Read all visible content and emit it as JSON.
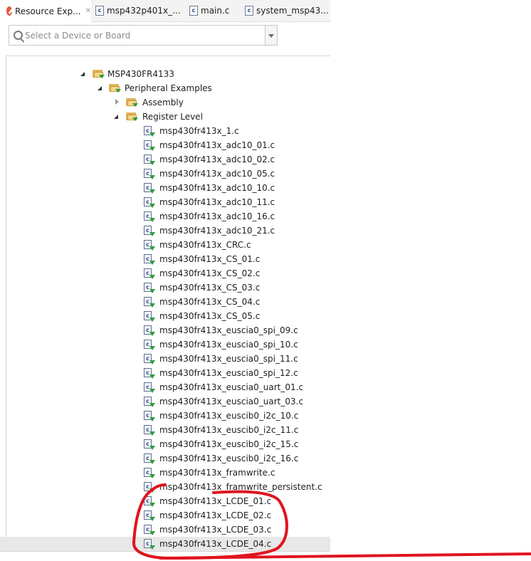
{
  "tabs": [
    {
      "label": "Resource Exp...",
      "icon": "compass-icon",
      "closable": true,
      "active": true
    },
    {
      "label": "msp432p401x_...",
      "icon": "c-file-icon"
    },
    {
      "label": "main.c",
      "icon": "c-file-icon"
    },
    {
      "label": "system_msp43...",
      "icon": "c-file-icon"
    }
  ],
  "close_glyph": "✕",
  "c_glyph": "c",
  "device_selector": {
    "placeholder": "Select a Device or Board",
    "search_icon": "search-icon",
    "dropdown_icon": "chevron-down-icon"
  },
  "tree": {
    "device": "MSP430FR4133",
    "peripheral_examples": "Peripheral Examples",
    "assembly": "Assembly",
    "register_level": "Register Level",
    "files": [
      "msp430fr413x_1.c",
      "msp430fr413x_adc10_01.c",
      "msp430fr413x_adc10_02.c",
      "msp430fr413x_adc10_05.c",
      "msp430fr413x_adc10_10.c",
      "msp430fr413x_adc10_11.c",
      "msp430fr413x_adc10_16.c",
      "msp430fr413x_adc10_21.c",
      "msp430fr413x_CRC.c",
      "msp430fr413x_CS_01.c",
      "msp430fr413x_CS_02.c",
      "msp430fr413x_CS_03.c",
      "msp430fr413x_CS_04.c",
      "msp430fr413x_CS_05.c",
      "msp430fr413x_euscia0_spi_09.c",
      "msp430fr413x_euscia0_spi_10.c",
      "msp430fr413x_euscia0_spi_11.c",
      "msp430fr413x_euscia0_spi_12.c",
      "msp430fr413x_euscia0_uart_01.c",
      "msp430fr413x_euscia0_uart_03.c",
      "msp430fr413x_euscib0_i2c_10.c",
      "msp430fr413x_euscib0_i2c_11.c",
      "msp430fr413x_euscib0_i2c_15.c",
      "msp430fr413x_euscib0_i2c_16.c",
      "msp430fr413x_framwrite.c",
      "msp430fr413x_framwrite_persistent.c",
      "msp430fr413x_LCDE_01.c",
      "msp430fr413x_LCDE_02.c",
      "msp430fr413x_LCDE_03.c",
      "msp430fr413x_LCDE_04.c"
    ],
    "selected_file": "msp430fr413x_LCDE_04.c"
  },
  "colors": {
    "folder": "#e0b358",
    "download_arrow": "#2e9c3a",
    "annotation": "#e0141e",
    "selection": "#e8e8e8"
  }
}
